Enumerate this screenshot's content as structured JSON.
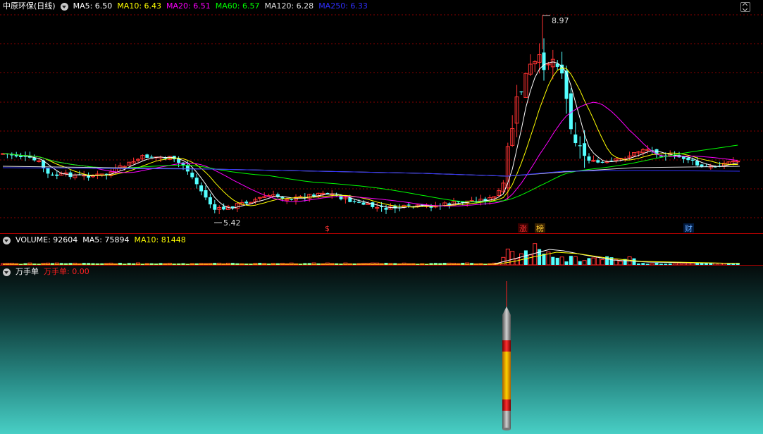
{
  "main_chart": {
    "stock_name": "中原环保",
    "period": "(日线)",
    "indicators": [
      {
        "label": "MA5: 6.50",
        "color": "#ffffff"
      },
      {
        "label": "MA10: 6.43",
        "color": "#ffff00"
      },
      {
        "label": "MA20: 6.51",
        "color": "#ff00ff"
      },
      {
        "label": "MA60: 6.57",
        "color": "#00ff00"
      },
      {
        "label": "MA120: 6.28",
        "color": "#e0e0e0"
      },
      {
        "label": "MA250: 6.33",
        "color": "#2f2fff"
      }
    ],
    "high_label": "8.97",
    "low_label": "5.42",
    "markers": [
      {
        "text": "$",
        "color": "#ff3333"
      },
      {
        "text": "涨",
        "color": "#ff3333"
      },
      {
        "text": "榜",
        "color": "#ffcc33"
      },
      {
        "text": "财",
        "color": "#66aaff"
      }
    ]
  },
  "volume_chart": {
    "title": "VOLUME: 92604",
    "ma5": "MA5: 75894",
    "ma10": "MA10: 81448"
  },
  "wanshou_chart": {
    "title": "万手单",
    "value_label": "万手单: 0.00"
  },
  "colors": {
    "up": "#ff3232",
    "down": "#54ffff",
    "grid": "#8a0000",
    "divider": "#b00000"
  },
  "chart_data": {
    "type": "candlestick",
    "price_range": [
      5.2,
      9.2
    ],
    "high": 8.97,
    "low": 5.42,
    "series": [
      "MA5",
      "MA10",
      "MA20",
      "MA60",
      "MA120",
      "MA250"
    ]
  }
}
